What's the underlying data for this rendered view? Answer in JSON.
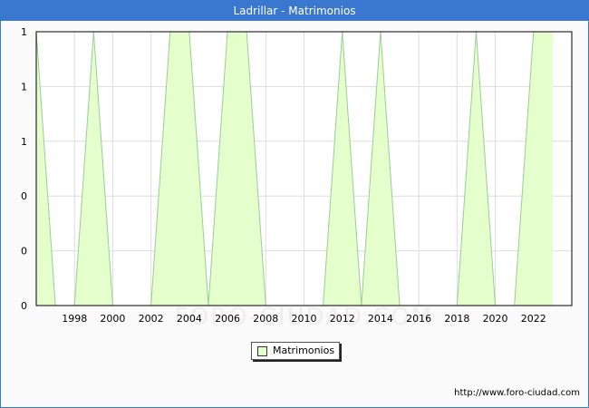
{
  "header": {
    "title": "Ladrillar - Matrimonios"
  },
  "footer": {
    "url": "http://www.foro-ciudad.com"
  },
  "watermark": "FORO-CIUDAD.COM",
  "colors": {
    "fill": "#e5ffcc",
    "stroke": "#99cc99",
    "title_bar": "#3a78d0",
    "grid": "#dddddd"
  },
  "chart_data": {
    "type": "area",
    "title": "Ladrillar - Matrimonios",
    "x": [
      1996,
      1997,
      1998,
      1999,
      2000,
      2001,
      2002,
      2003,
      2004,
      2005,
      2006,
      2007,
      2008,
      2009,
      2010,
      2011,
      2012,
      2013,
      2014,
      2015,
      2016,
      2017,
      2018,
      2019,
      2020,
      2021,
      2022,
      2023
    ],
    "series": [
      {
        "name": "Matrimonios",
        "values": [
          1,
          0,
          0,
          1,
          0,
          0,
          0,
          1,
          1,
          0,
          1,
          1,
          0,
          0,
          0,
          0,
          1,
          0,
          1,
          0,
          0,
          0,
          0,
          1,
          0,
          0,
          1,
          1
        ]
      }
    ],
    "x_ticks": [
      "1998",
      "2000",
      "2002",
      "2004",
      "2006",
      "2008",
      "2010",
      "2012",
      "2014",
      "2016",
      "2018",
      "2020",
      "2022"
    ],
    "x_tick_values": [
      1998,
      2000,
      2002,
      2004,
      2006,
      2008,
      2010,
      2012,
      2014,
      2016,
      2018,
      2020,
      2022
    ],
    "y_ticks": [
      "0",
      "0",
      "0",
      "1",
      "1",
      "1"
    ],
    "y_tick_values": [
      0,
      0.2,
      0.4,
      0.6,
      0.8,
      1.0
    ],
    "xlim": [
      1996,
      2024
    ],
    "ylim": [
      0,
      1
    ],
    "grid": true,
    "legend": "bottom-center"
  }
}
